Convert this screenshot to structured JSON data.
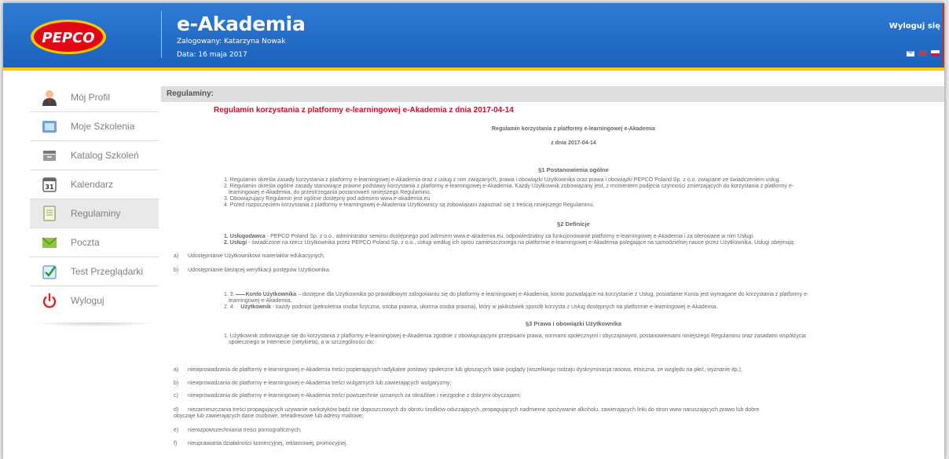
{
  "header": {
    "logo_text": "PEPCO",
    "app_title": "e-Akademia",
    "logged_in": "Zalogowany: Katarzyna Nowak",
    "date": "Data: 16 maja 2017",
    "logout": "Wyloguj się",
    "icons": [
      "envelope-icon",
      "flag-uk-icon",
      "flag-pl-icon"
    ],
    "colors": {
      "bar": "#1f67c2",
      "stripe": "#f6c800",
      "logo_red": "#e30613"
    }
  },
  "sidebar": {
    "items": [
      {
        "label": "Mój Profil",
        "icon": "user-icon"
      },
      {
        "label": "Moje Szkolenia",
        "icon": "courses-icon"
      },
      {
        "label": "Katalog Szkoleń",
        "icon": "catalog-icon"
      },
      {
        "label": "Kalendarz",
        "icon": "calendar-icon"
      },
      {
        "label": "Regulaminy",
        "icon": "document-icon",
        "active": true
      },
      {
        "label": "Poczta",
        "icon": "mail-icon"
      },
      {
        "label": "Test Przeglądarki",
        "icon": "checkbox-icon"
      },
      {
        "label": "Wyloguj",
        "icon": "power-icon"
      }
    ]
  },
  "content": {
    "section_label": "Regulaminy:",
    "doc_title": "Regulamin korzystania z platformy e-learningowej e-Akademia z dnia 2017-04-14",
    "sub_title": "Regulamin korzystania z platformy e-learningowej e-Akademia",
    "sub_date": "z dnia 2017-04-14",
    "s1_heading": "§1 Postanowienia ogólne",
    "s1": [
      "1. Regulamin określa zasady korzystania z platformy e-learningowej e-Akademia oraz z usług z nim związanych, prawa i obowiązki Użytkownika oraz prawa i obowiązki PEPCO Poland Sp. z o.o. związane ze świadczeniem usług.",
      "2. Regulamin określa ogólne zasady stanowiące prawne podstawy korzystania z platformy e-learningowej e-Akademia. Każdy Użytkownik zobowiązany jest, z momentem podjęcia czynności zmierzających do korzystania z platformy e-",
      "learningowej e-Akademia, do przestrzegania postanowień niniejszego Regulaminu.",
      "3. Obowiązujący Regulamin jest ogólnie dostępny pod adresem www.e-akademia.eu",
      "4. Przed rozpoczęciem korzystania z platformy e-learningowej e-Akademia Użytkownicy są zobowiązani zapoznać się z treścią niniejszego Regulaminu."
    ],
    "s2_heading": "§2 Definicje",
    "s2_item1_term": "1. Usługodawca",
    "s2_item1": " - PEPCO Poland Sp. z o.o., administrator serwisu dostępnego pod adresem www.e-akademia.eu, odpowiedzialny za funkcjonowanie platformy e-learningowej e-Akademia i za oferowane w nim Usługi.",
    "s2_item2_term": "2. Usługi",
    "s2_item2": " - świadczone na rzecz Użytkownika przez PEPCO Poland Sp. z o.o., usługi według ich opisu zamieszczonego na platformie e-learningowej e-Akademia polegające na samodzielnej nauce przez Użytkownika. Usługi obejmują:",
    "s2_a_letter": "a)",
    "s2_a": "Udostępnianie Użytkownikowi materiałów edukacyjnych,",
    "s2_b_letter": "b)",
    "s2_b": "Udostępnianie bieżącej weryfikacji postępów Użytkownika.",
    "s2_item3_prefix": "1. 3.",
    "s2_item3_term": "Konto Użytkownika",
    "s2_item3": " – dostępne dla Użytkownika po prawidłowym zalogowaniu się do platformy e-learningowej e-Akademia, konto pozwalające na korzystanie z Usług, posiadanie Konta jest wymagane do korzystania z platformy e-",
    "s2_item3b": "learningowej e-Akademia.",
    "s2_item4_prefix": "2. 4.",
    "s2_item4_term": "Użytkownik",
    "s2_item4": " - każdy podmiot (pełnoletnia osoba fizyczna, osoba prawna, ułomna osoba prawna), który w jakikolwiek sposób korzysta z Usług dostępnych na platformie e-learningowej e-Akademia.",
    "s3_heading": "§3 Prawa i obowiązki Użytkownika",
    "s3_p1": "1. Użytkownik zobowiązuje się do korzystania z platformy e-learningowej e-Akademia zgodnie z obowiązującymi przepisami prawa, normami społecznymi i obyczajowymi, postanowieniami niniejszego Regulaminu oraz zasadami współżycia",
    "s3_p1b": "społecznego w Internecie (netykieta), a w szczególności do:",
    "s3_list": [
      {
        "letter": "a)",
        "text": "niewprowadzania do platformy e-learningowej e-Akademia treści popierających radykalne postawy społeczne lub głoszących takie poglądy (wszelkiego rodzaju dyskryminacja rasowa, etniczna, ze względu na płeć, wyznanie itp.);"
      },
      {
        "letter": "b)",
        "text": "niewprowadzania do platformy e-learningowej e-Akademia treści wulgarnych lub zawierających wulgaryzmy;"
      },
      {
        "letter": "c)",
        "text": "niewprowadzania do platformy e-learningowej e-Akademia treści powszechnie uznanych za obraźliwe i niezgodne z dobrymi obyczajami;"
      },
      {
        "letter": "d)",
        "text": "niezamieszczania treści propagujących używanie narkotyków bądź nie dopuszczonych do obrotu środków odurzających, propagujących nadmierne spożywanie alkoholu, zawierających linki do stron www naruszających prawo lub dobre",
        "text2": "obyczaje lub zawierających dane osobowe, teleadresowe lub adresy mailowe;"
      },
      {
        "letter": "e)",
        "text": "nierozpowszechniania treści pornograficznych;"
      },
      {
        "letter": "f)",
        "text": "nieuprawiania działalności komercyjnej, reklamowej, promocyjnej."
      }
    ]
  }
}
